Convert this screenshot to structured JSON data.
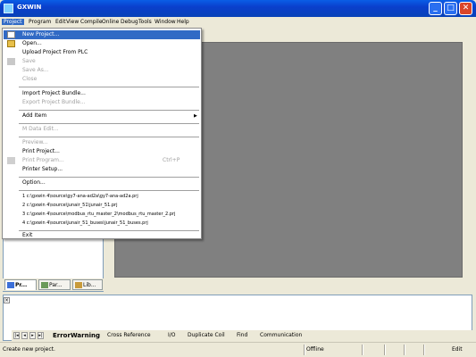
{
  "window": {
    "title": "GXWIN"
  },
  "menubar": {
    "items": [
      "Project",
      "Program",
      "Edit",
      "View",
      "Compile",
      "Online",
      "Debug",
      "Tools",
      "Window",
      "Help"
    ]
  },
  "project_menu": {
    "new_project": "New Project...",
    "open": "Open...",
    "upload": "Upload Project From PLC",
    "save": "Save",
    "save_as": "Save As...",
    "close": "Close",
    "import_bundle": "Import Project Bundle...",
    "export_bundle": "Export Project Bundle...",
    "add_item": "Add Item",
    "mdata_edit": "M Data Edit...",
    "preview": "Preview...",
    "print_project": "Print Project...",
    "print_program": "Print Program...",
    "print_program_shortcut": "Ctrl+P",
    "printer_setup": "Printer Setup...",
    "option": "Option...",
    "recent": [
      "1 c:\\gxwin 4\\source\\gy7-ana-ad2a\\gy7-ana-ad2a.prj",
      "2 c:\\gxwin 4\\source\\junair_51\\junair_51.prj",
      "3 c:\\gxwin 4\\source\\modbus_rtu_master_2\\modbus_rtu_master_2.prj",
      "4 c:\\gxwin 4\\source\\junair_51_buses\\junair_51_buses.prj"
    ],
    "exit": "Exit"
  },
  "left_tabs": [
    "Pr...",
    "Par...",
    "Lib..."
  ],
  "output": {
    "tabs": [
      "ErrorWarning",
      "Cross Reference",
      "I/O",
      "Duplicate Coil",
      "Find",
      "Communication"
    ]
  },
  "statusbar": {
    "message": "Create new project.",
    "connection": "Offline",
    "mode": "Edit"
  },
  "colors": {
    "titlebar": "#0a3fcc",
    "menu_highlight": "#316ac5",
    "editor_bg": "#808080",
    "chrome": "#ece9d8"
  }
}
